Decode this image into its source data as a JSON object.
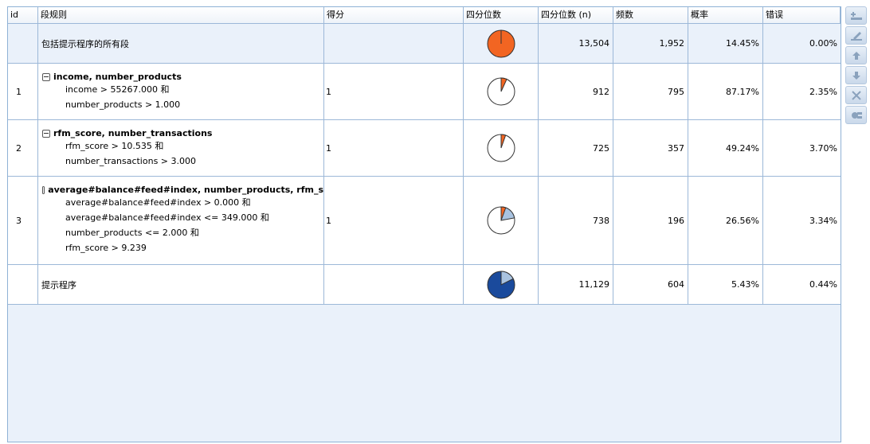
{
  "columns": {
    "id": "id",
    "rule": "段规则",
    "score": "得分",
    "quartile": "四分位数",
    "quartile_n": "四分位数 (n)",
    "freq": "频数",
    "prob": "概率",
    "error": "错误"
  },
  "rows": [
    {
      "id": "",
      "label": "包括提示程序的所有段",
      "score": "",
      "pie": {
        "fraction": 1.0,
        "style": "full-orange"
      },
      "quartile_n": "13,504",
      "freq": "1,952",
      "prob": "14.45%",
      "error": "0.00%"
    },
    {
      "id": "1",
      "segment_title": "income, number_products",
      "conditions": [
        "income > 55267.000 和",
        "number_products > 1.000"
      ],
      "score": "1",
      "pie": {
        "fraction": 0.068,
        "style": "slice-orange"
      },
      "quartile_n": "912",
      "freq": "795",
      "prob": "87.17%",
      "error": "2.35%"
    },
    {
      "id": "2",
      "segment_title": "rfm_score, number_transactions",
      "conditions": [
        "rfm_score > 10.535 和",
        "number_transactions > 3.000"
      ],
      "score": "1",
      "pie": {
        "fraction": 0.054,
        "style": "slice-orange"
      },
      "quartile_n": "725",
      "freq": "357",
      "prob": "49.24%",
      "error": "3.70%"
    },
    {
      "id": "3",
      "segment_title": "average#balance#feed#index, number_products, rfm_s",
      "conditions": [
        "average#balance#feed#index > 0.000 和",
        "average#balance#feed#index <= 349.000 和",
        "number_products <= 2.000 和",
        "rfm_score > 9.239"
      ],
      "score": "1",
      "pie": {
        "fraction": 0.055,
        "style": "slice-orange-blue"
      },
      "quartile_n": "738",
      "freq": "196",
      "prob": "26.56%",
      "error": "3.34%"
    },
    {
      "id": "",
      "label": "提示程序",
      "score": "",
      "pie": {
        "fraction": 0.824,
        "style": "blue-remainder"
      },
      "quartile_n": "11,129",
      "freq": "604",
      "prob": "5.43%",
      "error": "0.44%"
    }
  ],
  "toolbar": [
    {
      "icon": "insert-segment-icon"
    },
    {
      "icon": "edit-segment-icon"
    },
    {
      "icon": "move-up-icon"
    },
    {
      "icon": "move-down-icon"
    },
    {
      "icon": "delete-icon"
    },
    {
      "icon": "generate-icon"
    }
  ],
  "colors": {
    "orange": "#f26522",
    "dark_blue": "#1a4a9c",
    "light_blue": "#a9c3e0",
    "grid_line": "#9cb8d8"
  }
}
